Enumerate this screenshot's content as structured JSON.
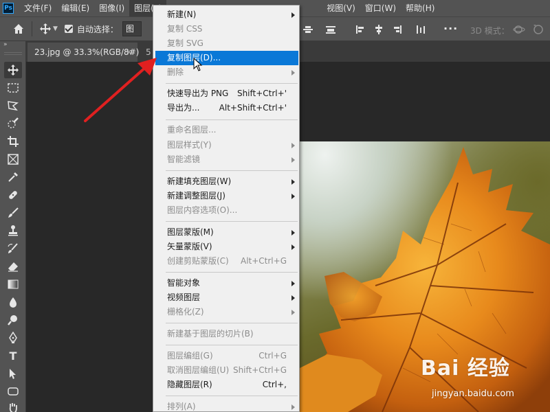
{
  "menubar": {
    "logo_text": "Ps",
    "items_left": [
      "文件(F)",
      "编辑(E)",
      "图像(I)",
      "图层(L)"
    ],
    "items_right": [
      "视图(V)",
      "窗口(W)",
      "帮助(H)"
    ]
  },
  "options_bar": {
    "auto_select_label": "自动选择：",
    "layer_select_value": "图层",
    "mode_3d_label": "3D 模式："
  },
  "tabs": {
    "doc1_label": "23.jpg @ 33.3%(RGB/8#)",
    "doc1_close": "×",
    "doc2_label": "5"
  },
  "toolbar": {
    "collapse_glyph": "»",
    "type_tool_letter": "T"
  },
  "layer_menu": {
    "items": [
      {
        "label": "新建(N)",
        "shortcut": "",
        "disabled": false,
        "submenu": true
      },
      {
        "label": "复制 CSS",
        "shortcut": "",
        "disabled": true,
        "submenu": false
      },
      {
        "label": "复制 SVG",
        "shortcut": "",
        "disabled": true,
        "submenu": false
      },
      {
        "label": "复制图层(D)...",
        "shortcut": "",
        "disabled": false,
        "submenu": false,
        "highlighted": true
      },
      {
        "label": "删除",
        "shortcut": "",
        "disabled": true,
        "submenu": true
      },
      {
        "label": "快速导出为 PNG",
        "shortcut": "Shift+Ctrl+'",
        "disabled": false,
        "submenu": false
      },
      {
        "label": "导出为...",
        "shortcut": "Alt+Shift+Ctrl+'",
        "disabled": false,
        "submenu": false
      },
      {
        "label": "重命名图层...",
        "shortcut": "",
        "disabled": true,
        "submenu": false
      },
      {
        "label": "图层样式(Y)",
        "shortcut": "",
        "disabled": true,
        "submenu": true
      },
      {
        "label": "智能滤镜",
        "shortcut": "",
        "disabled": true,
        "submenu": true
      },
      {
        "label": "新建填充图层(W)",
        "shortcut": "",
        "disabled": false,
        "submenu": true
      },
      {
        "label": "新建调整图层(J)",
        "shortcut": "",
        "disabled": false,
        "submenu": true
      },
      {
        "label": "图层内容选项(O)...",
        "shortcut": "",
        "disabled": true,
        "submenu": false
      },
      {
        "label": "图层蒙版(M)",
        "shortcut": "",
        "disabled": false,
        "submenu": true
      },
      {
        "label": "矢量蒙版(V)",
        "shortcut": "",
        "disabled": false,
        "submenu": true
      },
      {
        "label": "创建剪贴蒙版(C)",
        "shortcut": "Alt+Ctrl+G",
        "disabled": true,
        "submenu": false
      },
      {
        "label": "智能对象",
        "shortcut": "",
        "disabled": false,
        "submenu": true
      },
      {
        "label": "视频图层",
        "shortcut": "",
        "disabled": false,
        "submenu": true
      },
      {
        "label": "栅格化(Z)",
        "shortcut": "",
        "disabled": true,
        "submenu": true
      },
      {
        "label": "新建基于图层的切片(B)",
        "shortcut": "",
        "disabled": true,
        "submenu": false
      },
      {
        "label": "图层编组(G)",
        "shortcut": "Ctrl+G",
        "disabled": true,
        "submenu": false
      },
      {
        "label": "取消图层编组(U)",
        "shortcut": "Shift+Ctrl+G",
        "disabled": true,
        "submenu": false
      },
      {
        "label": "隐藏图层(R)",
        "shortcut": "Ctrl+,",
        "disabled": false,
        "submenu": false
      },
      {
        "label": "排列(A)",
        "shortcut": "",
        "disabled": true,
        "submenu": true
      }
    ]
  },
  "watermark": {
    "main": "Bai 经验",
    "sub": "jingyan.baidu.com"
  },
  "colors": {
    "menubar_bg": "#535353",
    "canvas_bg": "#282828",
    "menu_bg": "#f0f0f0",
    "highlight": "#0a78d7",
    "arrow_red": "#e02020",
    "ps_blue": "#31a8ff"
  }
}
